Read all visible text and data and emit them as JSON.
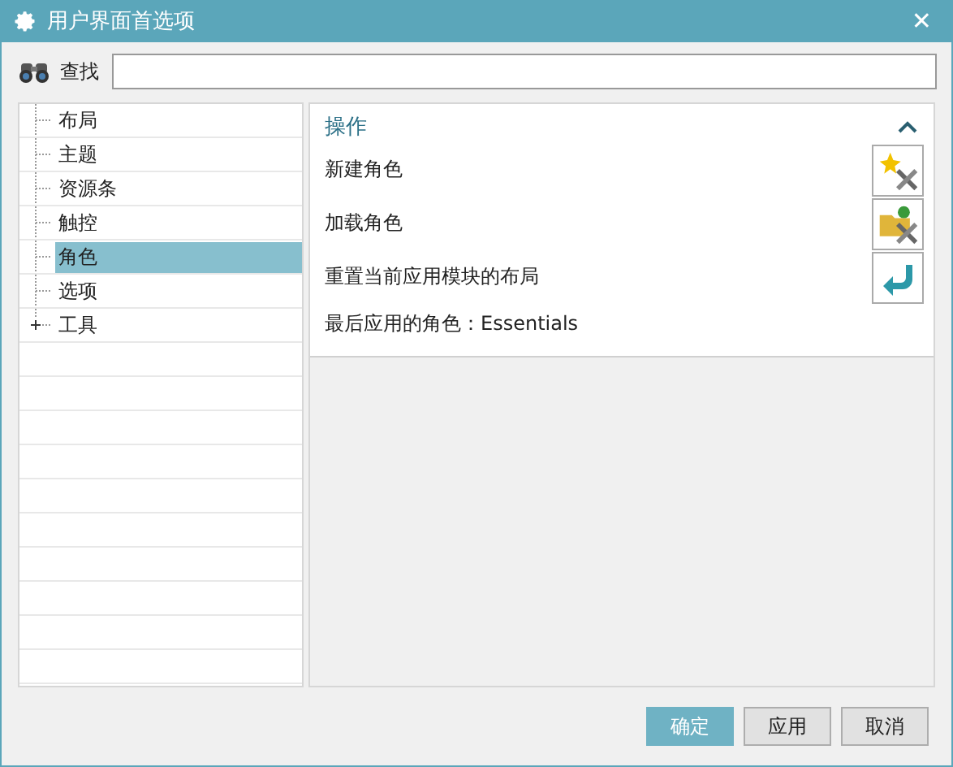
{
  "window": {
    "title": "用户界面首选项",
    "close": "✕"
  },
  "search": {
    "label": "查找"
  },
  "tree": {
    "items": [
      {
        "label": "布局",
        "kind": "leaf",
        "selected": false
      },
      {
        "label": "主题",
        "kind": "leaf",
        "selected": false
      },
      {
        "label": "资源条",
        "kind": "leaf",
        "selected": false
      },
      {
        "label": "触控",
        "kind": "leaf",
        "selected": false
      },
      {
        "label": "角色",
        "kind": "leaf",
        "selected": true
      },
      {
        "label": "选项",
        "kind": "leaf",
        "selected": false
      },
      {
        "label": "工具",
        "kind": "group",
        "expanded": false,
        "selected": false
      }
    ]
  },
  "section": {
    "title": "操作",
    "expanded": true,
    "rows": [
      {
        "label": "新建角色",
        "kind": "new"
      },
      {
        "label": "加载角色",
        "kind": "load"
      },
      {
        "label": "重置当前应用模块的布局",
        "kind": "reset"
      },
      {
        "label": "最后应用的角色：Essentials",
        "kind": "info"
      }
    ]
  },
  "buttons": [
    {
      "label": "确定",
      "kind": "primary"
    },
    {
      "label": "应用",
      "kind": "normal"
    },
    {
      "label": "取消",
      "kind": "normal"
    }
  ]
}
